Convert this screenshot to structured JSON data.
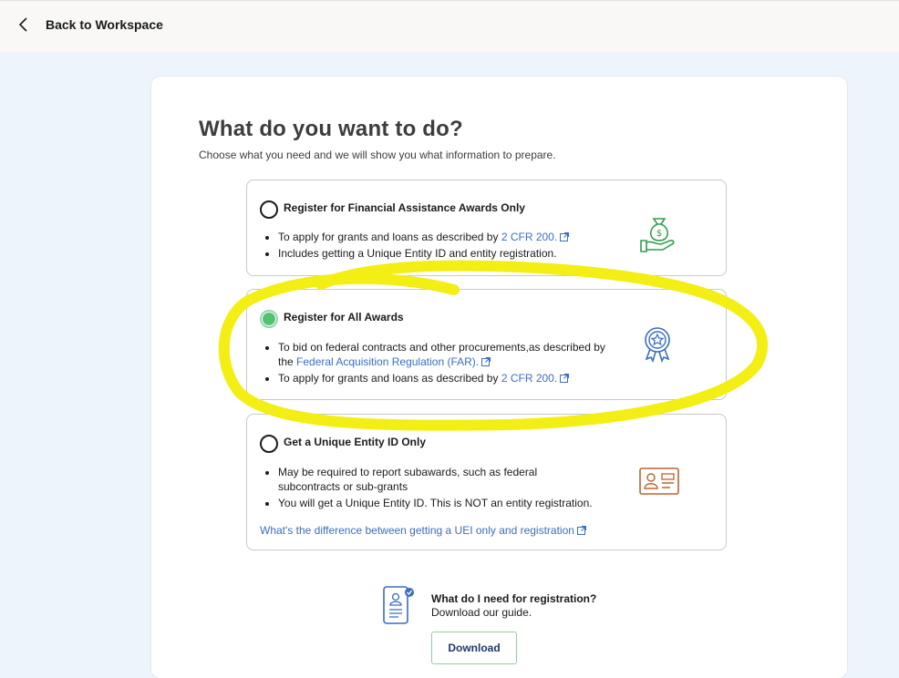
{
  "topbar": {
    "back_label": "Back to Workspace"
  },
  "main": {
    "title": "What do you want to do?",
    "subtitle": "Choose what you need and we will show you what information to prepare."
  },
  "options": [
    {
      "title": "Register for Financial Assistance Awards Only",
      "selected": false,
      "icon": "money-bag-hand-icon",
      "bullets": [
        {
          "text": "To apply for grants and loans as described by ",
          "link": "2 CFR 200."
        },
        {
          "text": "Includes getting a Unique Entity ID and entity registration.",
          "link": ""
        }
      ]
    },
    {
      "title": "Register for All Awards",
      "selected": true,
      "icon": "award-ribbon-icon",
      "bullets": [
        {
          "text": "To bid on federal contracts and other procurements,as described by the ",
          "link": "Federal Acquisition Regulation (FAR)."
        },
        {
          "text": "To apply for grants and loans as described by ",
          "link": "2 CFR 200."
        }
      ]
    },
    {
      "title": "Get a Unique Entity ID Only",
      "selected": false,
      "icon": "id-card-icon",
      "bullets": [
        {
          "text": "May be required to report subawards, such as federal subcontracts or sub-grants",
          "link": ""
        },
        {
          "text": "You will get a Unique Entity ID. This is NOT an entity registration.",
          "link": ""
        }
      ],
      "footer_link": "What's the difference between getting a UEI only and registration"
    }
  ],
  "guide": {
    "title": "What do I need for registration?",
    "subtitle": "Download our guide.",
    "button": "Download"
  },
  "colors": {
    "accent_link": "#3a6ec0",
    "selected_radio": "#54c271",
    "highlight_marker": "#f3ee14",
    "icon_green": "#2e9e4b",
    "icon_blue": "#3a6ec0",
    "icon_orange": "#c2622b"
  }
}
